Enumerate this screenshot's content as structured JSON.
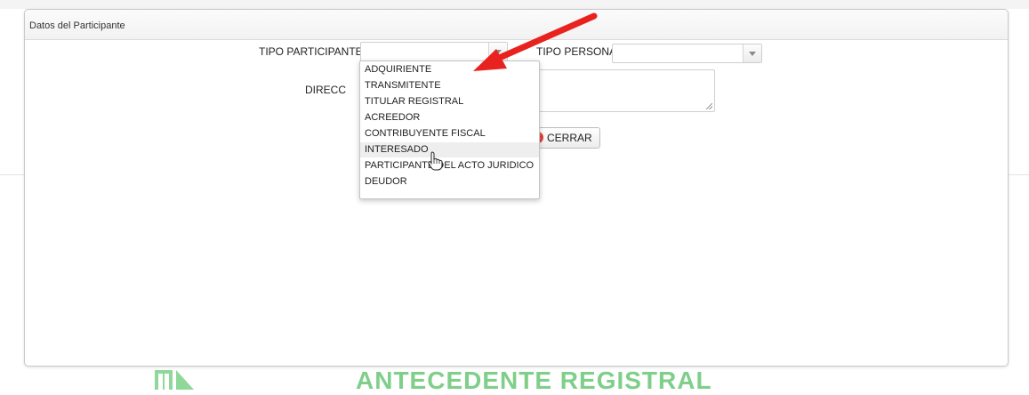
{
  "panel": {
    "title": "Datos del Participante"
  },
  "form": {
    "tipo_participante_label": "TIPO PARTICIPANTE",
    "tipo_persona_label": "TIPO PERSONA",
    "direccion_label_partial": "DIRECC",
    "tipo_participante_value": "",
    "tipo_persona_value": ""
  },
  "buttons": {
    "cerrar_label": "CERRAR"
  },
  "dropdown": {
    "options": [
      "ADQUIRIENTE",
      "TRANSMITENTE",
      "TITULAR REGISTRAL",
      "ACREEDOR",
      "CONTRIBUYENTE FISCAL",
      "INTERESADO",
      "PARTICIPANTE DEL ACTO JURIDICO",
      "DEUDOR"
    ],
    "hovered_option": "INTERESADO"
  },
  "background": {
    "heading": "ANTECEDENTE REGISTRAL"
  },
  "colors": {
    "annotation_arrow": "#e8231f",
    "close_icon": "#e0413c",
    "background_heading": "#7fcf8a"
  },
  "icons": {
    "close": "close-circle-icon",
    "dropdown": "chevron-down-icon",
    "cursor": "hand-pointer-icon",
    "annotation": "red-arrow-icon"
  }
}
